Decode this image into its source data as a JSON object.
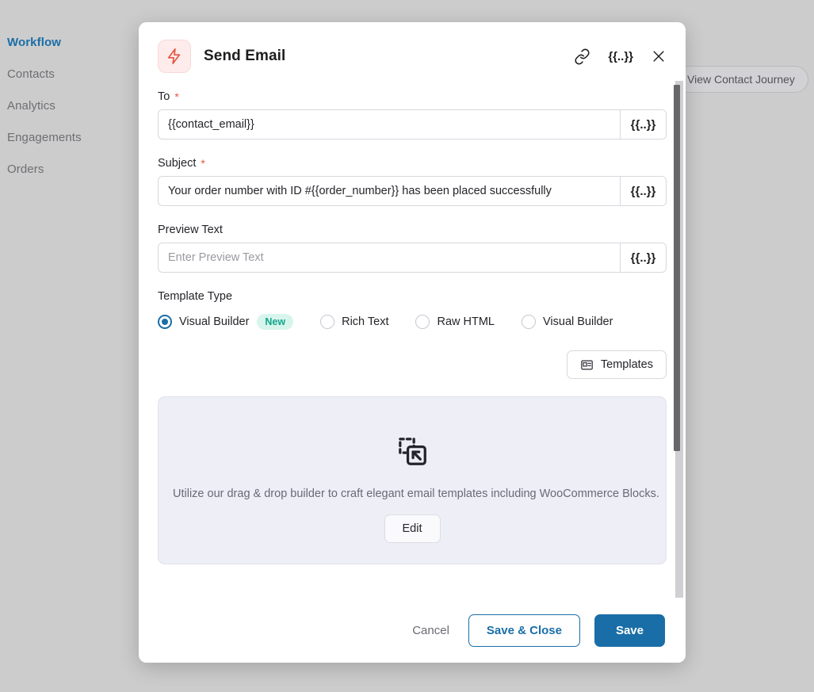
{
  "sidebar": {
    "items": [
      {
        "label": "Workflow",
        "active": true
      },
      {
        "label": "Contacts",
        "active": false
      },
      {
        "label": "Analytics",
        "active": false
      },
      {
        "label": "Engagements",
        "active": false
      },
      {
        "label": "Orders",
        "active": false
      }
    ]
  },
  "background": {
    "journey_button_label": "View Contact Journey"
  },
  "modal": {
    "title": "Send Email",
    "app_icon": "lightning-bolt-icon",
    "header_icons": {
      "link": "link-icon",
      "merge_tag": "{{..}}",
      "close": "close-icon"
    },
    "fields": {
      "to": {
        "label": "To",
        "required": "*",
        "value": "{{contact_email}}",
        "placeholder": "",
        "merge_tag": "{{..}}"
      },
      "subject": {
        "label": "Subject",
        "required": "*",
        "value": "Your order number with ID #{{order_number}} has been placed successfully",
        "placeholder": "",
        "merge_tag": "{{..}}"
      },
      "preview_text": {
        "label": "Preview Text",
        "required": "",
        "value": "",
        "placeholder": "Enter Preview Text",
        "merge_tag": "{{..}}"
      }
    },
    "template_type": {
      "label": "Template Type",
      "options": [
        {
          "label": "Visual Builder",
          "selected": true,
          "badge": "New"
        },
        {
          "label": "Rich Text",
          "selected": false,
          "badge": ""
        },
        {
          "label": "Raw HTML",
          "selected": false,
          "badge": ""
        },
        {
          "label": "Visual Builder",
          "selected": false,
          "badge": ""
        }
      ]
    },
    "templates_button": {
      "label": "Templates",
      "icon": "template-layout-icon"
    },
    "builder_panel": {
      "icon": "drag-drop-icon",
      "description": "Utilize our drag & drop builder to craft elegant email templates including WooCommerce Blocks.",
      "edit_label": "Edit"
    },
    "footer": {
      "cancel_label": "Cancel",
      "save_close_label": "Save & Close",
      "save_label": "Save"
    }
  },
  "colors": {
    "accent_blue": "#1a6ea8",
    "brand_red": "#e8543f",
    "badge_teal": "#12a58c",
    "panel_lavender": "#eeeef7"
  }
}
